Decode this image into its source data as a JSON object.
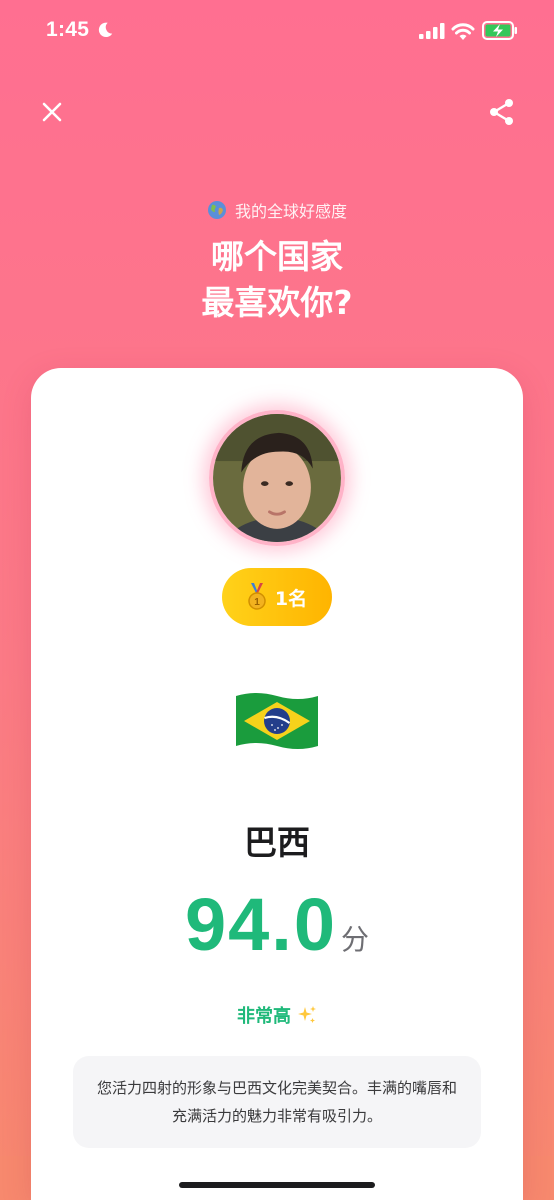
{
  "status_bar": {
    "time": "1:45",
    "icons": [
      "moon-icon",
      "signal-icon",
      "wifi-icon",
      "battery-charging-icon"
    ]
  },
  "nav": {
    "close_icon": "close-icon",
    "share_icon": "share-icon"
  },
  "header": {
    "subtitle": "我的全球好感度",
    "title_line1": "哪个国家",
    "title_line2": "最喜欢你?"
  },
  "result": {
    "rank_label": "1名",
    "rank_icon": "gold-medal-icon",
    "flag_icon": "brazil-flag-icon",
    "country": "巴西",
    "score": "94.0",
    "score_unit": "分",
    "level": "非常高",
    "level_icon": "sparkles-icon",
    "description": "您活力四射的形象与巴西文化完美契合。丰满的嘴唇和充满活力的魅力非常有吸引力。"
  },
  "colors": {
    "background_top": "#ff6f91",
    "background_bottom": "#f7896e",
    "score_green": "#1fb97a",
    "badge_gold": "#ffc107"
  }
}
